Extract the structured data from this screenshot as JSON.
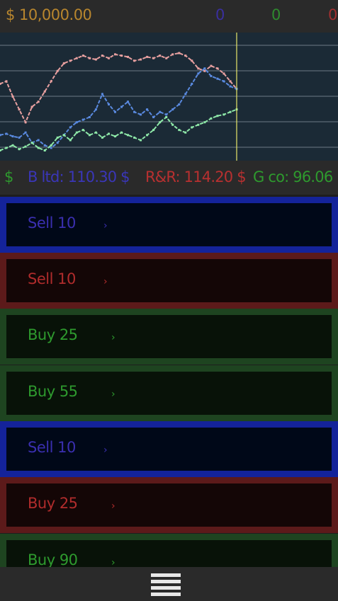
{
  "top": {
    "cash": "$ 10,000.00",
    "holdings": [
      {
        "value": "0",
        "color": "#3a2f9e"
      },
      {
        "value": "0",
        "color": "#2e8a2e"
      },
      {
        "value": "0",
        "color": "#a03030"
      }
    ]
  },
  "tickers": {
    "partial": "$",
    "items": [
      {
        "label": "B ltd: 110.30 $",
        "color": "#3a36b8"
      },
      {
        "label": "R&R: 114.20 $",
        "color": "#b83030"
      },
      {
        "label": "G co: 96.06",
        "color": "#2e9a2e"
      }
    ]
  },
  "chart_data": {
    "type": "line",
    "grid": "horizontal",
    "series": [
      {
        "color": "#e8a0a0",
        "values": [
          60,
          62,
          50,
          40,
          30,
          42,
          46,
          54,
          62,
          70,
          76,
          78,
          80,
          82,
          80,
          79,
          82,
          80,
          83,
          82,
          81,
          78,
          79,
          81,
          80,
          82,
          80,
          83,
          84,
          82,
          78,
          72,
          70,
          74,
          72,
          68,
          62,
          56
        ]
      },
      {
        "color": "#5a8ae0",
        "values": [
          20,
          21,
          19,
          18,
          22,
          14,
          16,
          12,
          10,
          14,
          20,
          26,
          30,
          32,
          34,
          40,
          52,
          44,
          38,
          42,
          46,
          38,
          36,
          40,
          34,
          38,
          36,
          40,
          44,
          52,
          60,
          68,
          72,
          66,
          64,
          62,
          58,
          56
        ]
      },
      {
        "color": "#8ee8a8",
        "values": [
          8,
          10,
          12,
          9,
          11,
          14,
          10,
          8,
          12,
          18,
          20,
          16,
          22,
          24,
          20,
          22,
          18,
          21,
          19,
          22,
          20,
          18,
          16,
          20,
          24,
          30,
          34,
          28,
          24,
          22,
          26,
          28,
          30,
          33,
          35,
          36,
          38,
          40
        ]
      }
    ]
  },
  "orders": [
    {
      "label": "Sell 10",
      "theme": "blue"
    },
    {
      "label": "Sell 10",
      "theme": "red"
    },
    {
      "label": "Buy 25",
      "theme": "green"
    },
    {
      "label": "Buy 55",
      "theme": "green"
    },
    {
      "label": "Sell 10",
      "theme": "blue"
    },
    {
      "label": "Buy 25",
      "theme": "red"
    },
    {
      "label": "Buy 90",
      "theme": "green"
    }
  ],
  "chevron": "›",
  "icons": {
    "menu": "hamburger-menu-icon"
  }
}
